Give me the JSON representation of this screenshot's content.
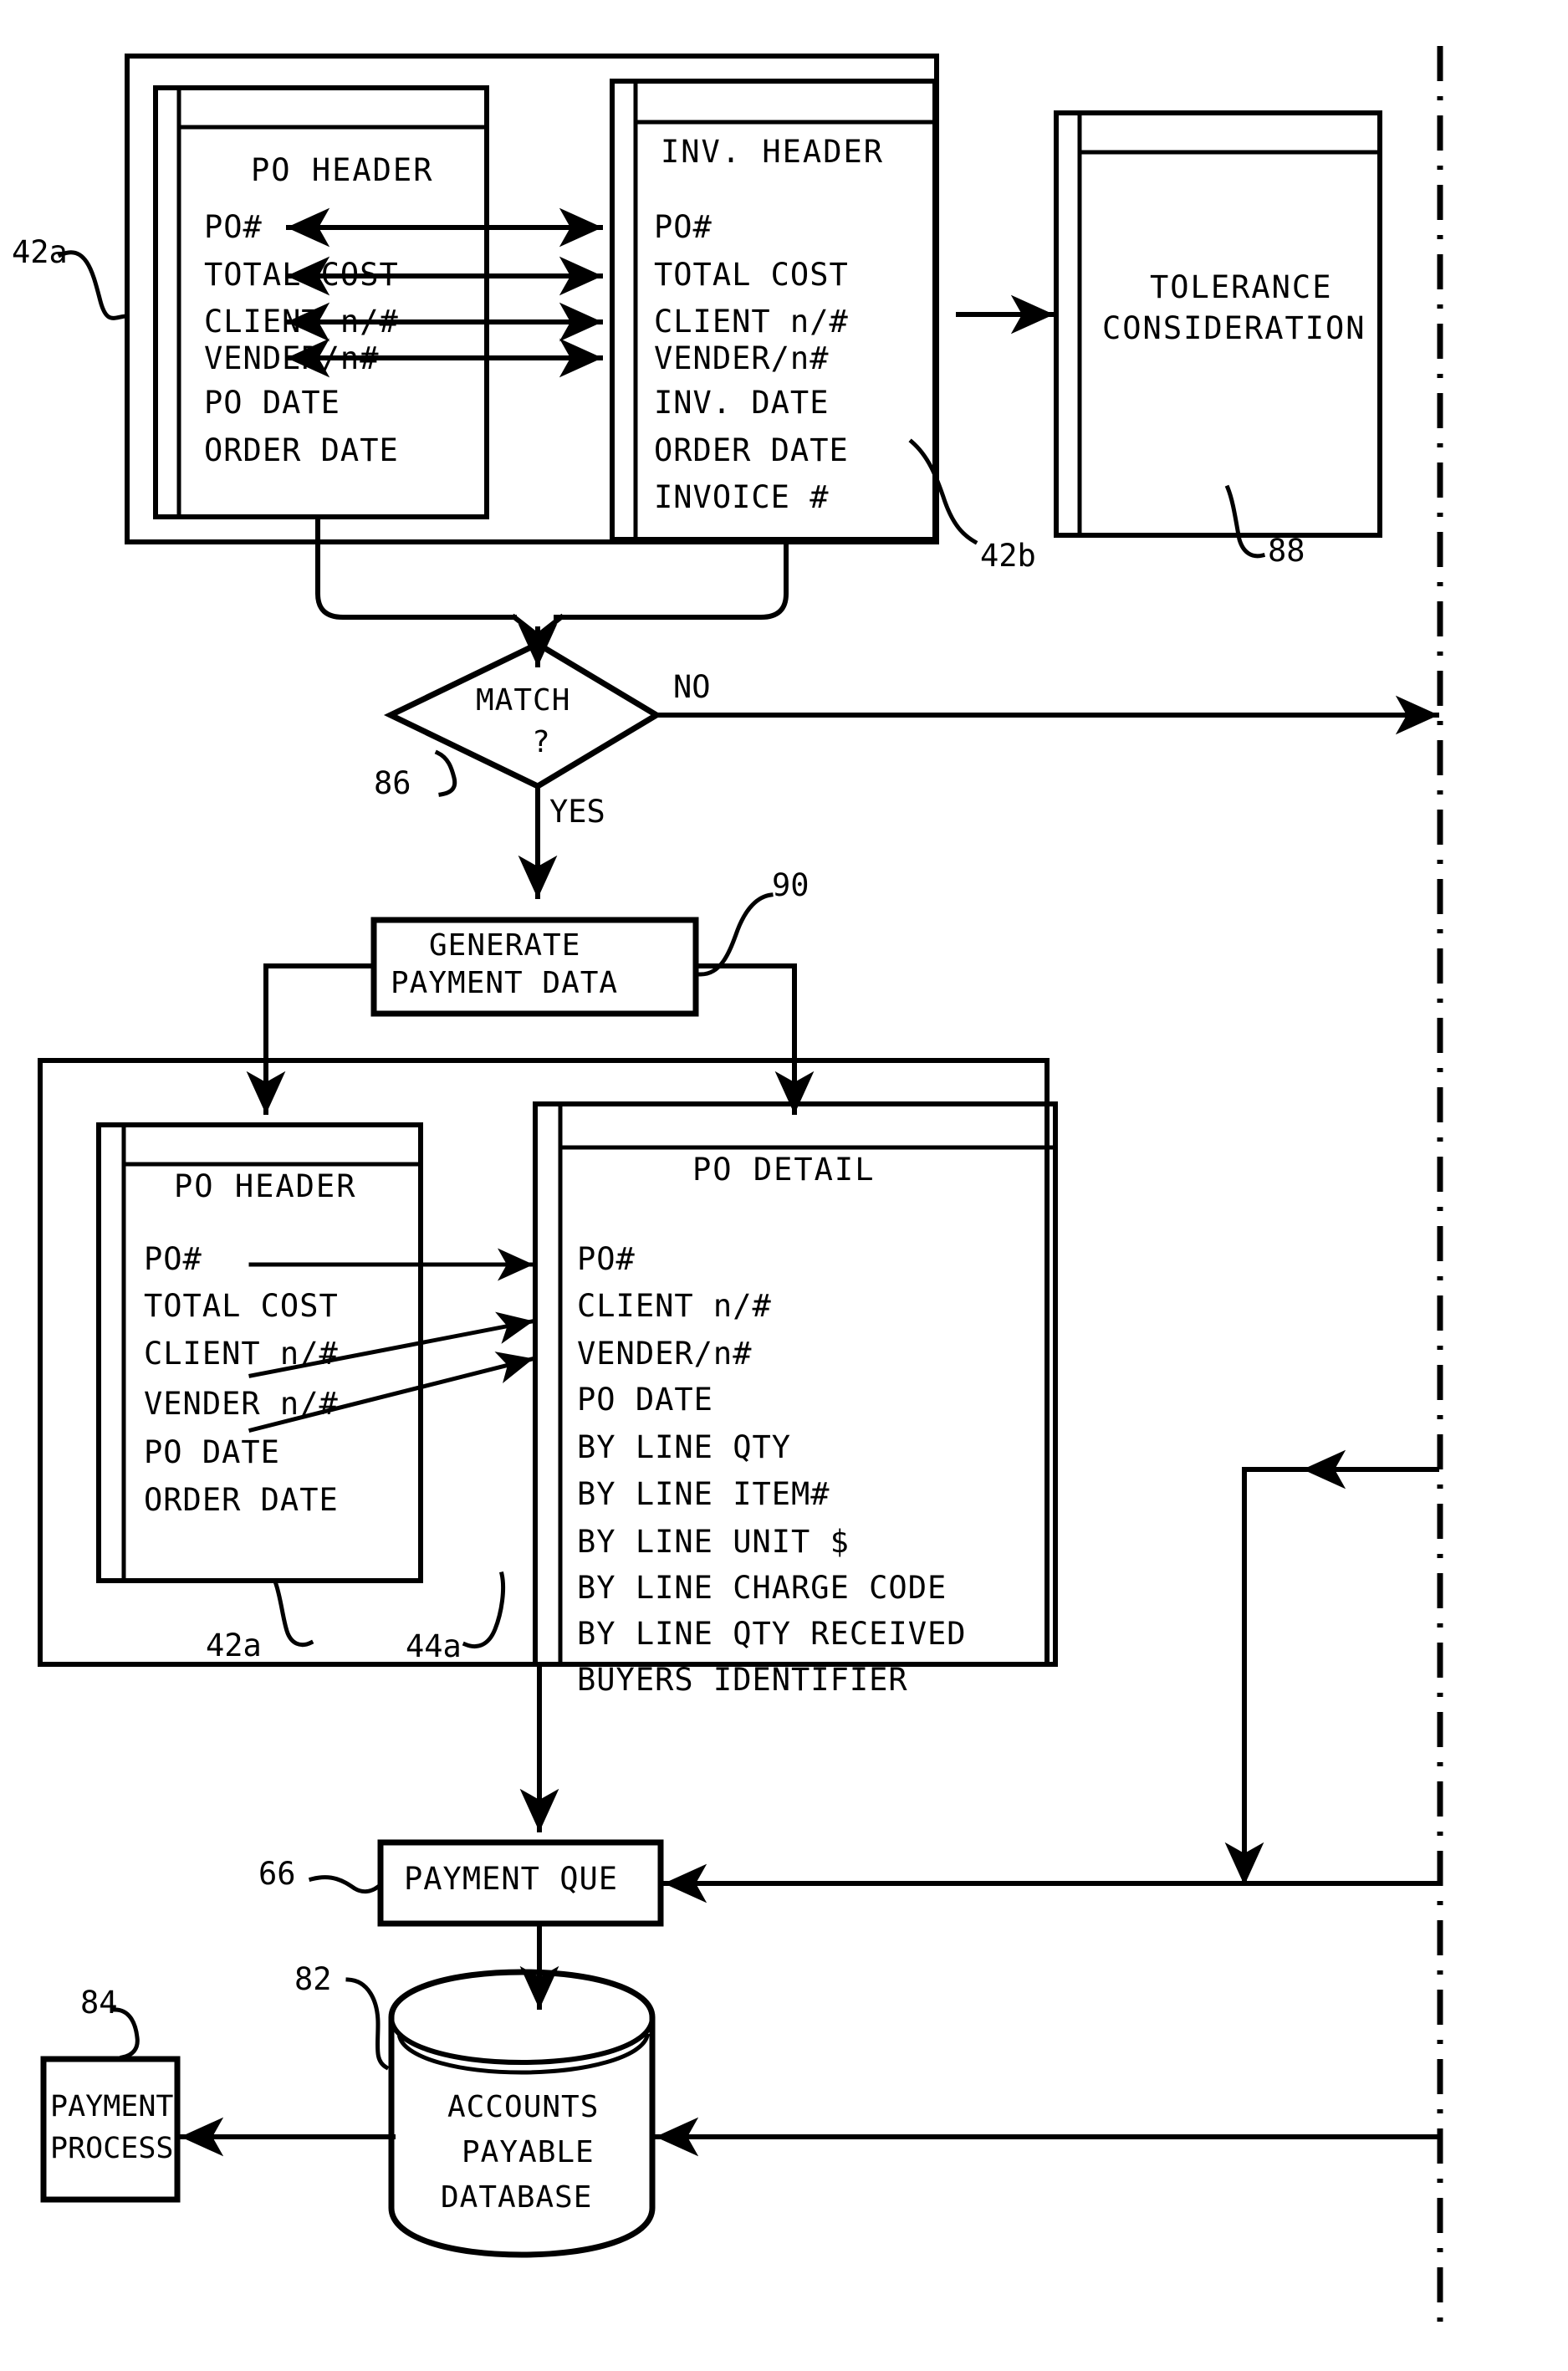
{
  "figure": {
    "type": "patent-flowchart",
    "title_text": "",
    "boundary": "dash-dot vertical divider at right"
  },
  "nodes": {
    "po_header_top": {
      "title": "PO HEADER",
      "ref": "42a",
      "fields": [
        "PO#",
        "TOTAL COST",
        "CLIENT n/#",
        "VENDER/n#",
        "PO DATE",
        "ORDER DATE"
      ]
    },
    "inv_header": {
      "title": "INV. HEADER",
      "ref": "42b",
      "fields": [
        "PO#",
        "TOTAL COST",
        "CLIENT n/#",
        "VENDER/n#",
        "INV. DATE",
        "ORDER DATE",
        "INVOICE #"
      ]
    },
    "tolerance": {
      "line1": "TOLERANCE",
      "line2": "CONSIDERATION",
      "ref": "88"
    },
    "match": {
      "line1": "MATCH",
      "line2": "?",
      "ref": "86",
      "branch_no": "NO",
      "branch_yes": "YES"
    },
    "generate": {
      "line1": "GENERATE",
      "line2": "PAYMENT DATA",
      "ref": "90"
    },
    "po_header_bottom": {
      "title": "PO HEADER",
      "ref": "42a",
      "fields": [
        "PO#",
        "TOTAL COST",
        "CLIENT n/#",
        "VENDER n/#",
        "PO DATE",
        "ORDER DATE"
      ]
    },
    "po_detail": {
      "title": "PO DETAIL",
      "ref": "44a",
      "fields": [
        "PO#",
        "CLIENT n/#",
        "VENDER/n#",
        "PO DATE",
        "BY LINE QTY",
        "BY LINE ITEM#",
        "BY LINE UNIT $",
        "BY LINE CHARGE CODE",
        "BY LINE QTY RECEIVED",
        "BUYERS IDENTIFIER"
      ]
    },
    "payment_que": {
      "label": "PAYMENT QUE",
      "ref": "66"
    },
    "accounts_db": {
      "line1": "ACCOUNTS",
      "line2": "PAYABLE",
      "line3": "DATABASE",
      "ref": "82"
    },
    "payment_process": {
      "line1": "PAYMENT",
      "line2": "PROCESS",
      "ref": "84"
    }
  },
  "colors": {
    "ink": "#000000",
    "paper": "#ffffff"
  }
}
